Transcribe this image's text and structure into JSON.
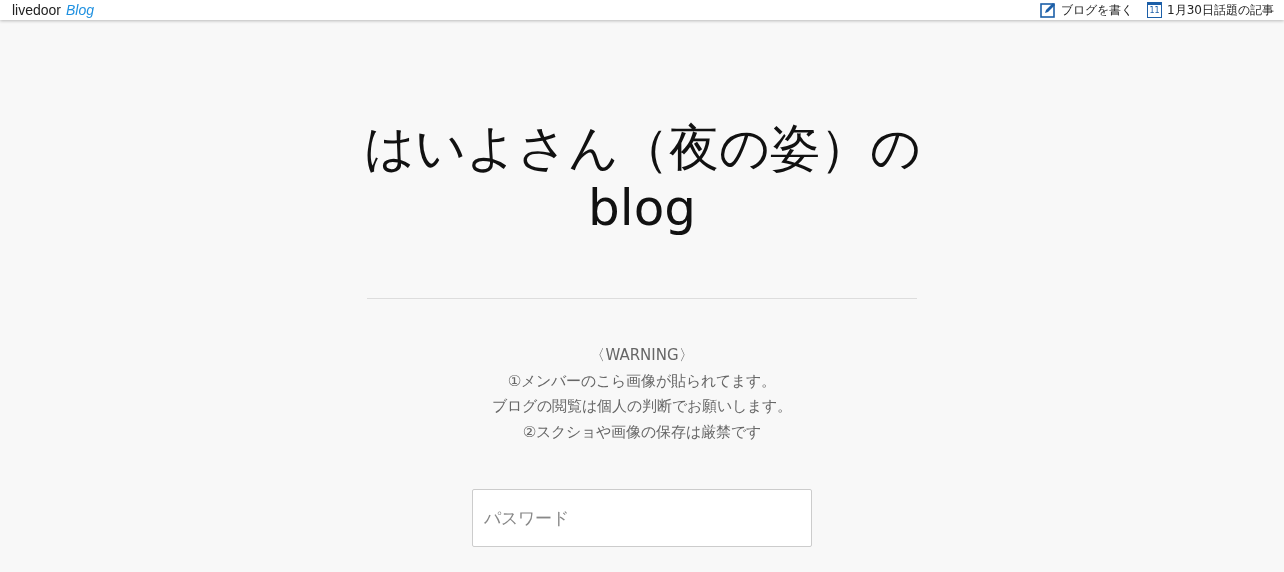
{
  "header": {
    "logo_main": "livedoor",
    "logo_sub": "Blog",
    "links": [
      {
        "kind": "write",
        "label": "ブログを書く"
      },
      {
        "kind": "calendar",
        "label": "1月30日話題の記事",
        "day": "11"
      }
    ]
  },
  "blog_title": "はいよさん（夜の姿）のblog",
  "warning_lines": [
    "〈WARNING〉",
    "①メンバーのこら画像が貼られてます。",
    "ブログの閲覧は個人の判断でお願いします。",
    "②スクショや画像の保存は厳禁です"
  ],
  "password": {
    "placeholder": "パスワード"
  }
}
